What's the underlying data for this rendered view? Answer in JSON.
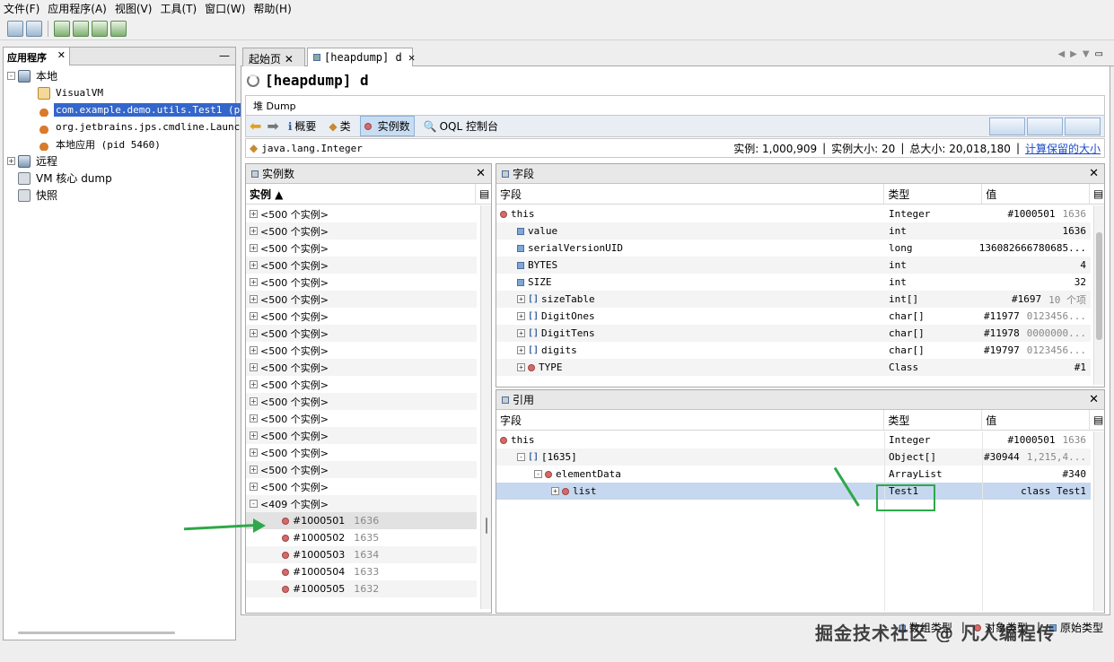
{
  "menu": [
    "文件(F)",
    "应用程序(A)",
    "视图(V)",
    "工具(T)",
    "窗口(W)",
    "帮助(H)"
  ],
  "left": {
    "tab": "应用程序",
    "tree": [
      {
        "label": "本地",
        "icon": "computer-icon",
        "level": 0,
        "exp": "-"
      },
      {
        "label": "VisualVM",
        "icon": "visualvm-icon",
        "level": 1
      },
      {
        "label": "com.example.demo.utils.Test1 (pid",
        "icon": "java-icon",
        "level": 1,
        "selected": true
      },
      {
        "label": "org.jetbrains.jps.cmdline.Launcher",
        "icon": "java-icon",
        "level": 1
      },
      {
        "label": "本地应用 (pid 5460)",
        "icon": "java-icon",
        "level": 1
      },
      {
        "label": "远程",
        "icon": "remote-icon",
        "level": 0,
        "exp": "+"
      },
      {
        "label": "VM 核心 dump",
        "icon": "vm-core-icon",
        "level": 0
      },
      {
        "label": "快照",
        "icon": "snapshot-icon",
        "level": 0
      }
    ]
  },
  "doctabs": [
    "起始页",
    "[heapdump] d"
  ],
  "title": "[heapdump] d",
  "sub": "堆 Dump",
  "views": [
    "概要",
    "类",
    "实例数",
    "OQL 控制台"
  ],
  "classbar": {
    "name": "java.lang.Integer",
    "instances": "实例: 1,000,909",
    "size": "实例大小: 20",
    "total": "总大小: 20,018,180",
    "link": "计算保留的大小"
  },
  "instances": {
    "title": "实例数",
    "col": "实例 ▲",
    "groups": [
      "<500 个实例>",
      "<500 个实例>",
      "<500 个实例>",
      "<500 个实例>",
      "<500 个实例>",
      "<500 个实例>",
      "<500 个实例>",
      "<500 个实例>",
      "<500 个实例>",
      "<500 个实例>",
      "<500 个实例>",
      "<500 个实例>",
      "<500 个实例>",
      "<500 个实例>",
      "<500 个实例>",
      "<500 个实例>",
      "<500 个实例>",
      "<409 个实例>"
    ],
    "items": [
      {
        "id": "#1000501",
        "v": "1636"
      },
      {
        "id": "#1000502",
        "v": "1635"
      },
      {
        "id": "#1000503",
        "v": "1634"
      },
      {
        "id": "#1000504",
        "v": "1633"
      },
      {
        "id": "#1000505",
        "v": "1632"
      }
    ]
  },
  "fields": {
    "title": "字段",
    "cols": [
      "字段",
      "类型",
      "值"
    ],
    "rows": [
      {
        "n": "this",
        "t": "Integer",
        "v": "#1000501",
        "v2": "1636",
        "ic": "dot",
        "ind": 0
      },
      {
        "n": "value",
        "t": "int",
        "v": "1636",
        "ic": "sq",
        "ind": 1
      },
      {
        "n": "serialVersionUID",
        "t": "long",
        "v": "136082666780685...",
        "ic": "sq",
        "ind": 1
      },
      {
        "n": "BYTES",
        "t": "int",
        "v": "4",
        "ic": "sq",
        "ind": 1
      },
      {
        "n": "SIZE",
        "t": "int",
        "v": "32",
        "ic": "sq",
        "ind": 1
      },
      {
        "n": "sizeTable",
        "t": "int[]",
        "v": "#1697",
        "v2": "10 个项",
        "ic": "arr",
        "ind": 1,
        "exp": "+"
      },
      {
        "n": "DigitOnes",
        "t": "char[]",
        "v": "#11977",
        "v2": "0123456...",
        "ic": "arr",
        "ind": 1,
        "exp": "+"
      },
      {
        "n": "DigitTens",
        "t": "char[]",
        "v": "#11978",
        "v2": "0000000...",
        "ic": "arr",
        "ind": 1,
        "exp": "+"
      },
      {
        "n": "digits",
        "t": "char[]",
        "v": "#19797",
        "v2": "0123456...",
        "ic": "arr",
        "ind": 1,
        "exp": "+"
      },
      {
        "n": "TYPE",
        "t": "Class",
        "v": "#1",
        "ic": "dot",
        "ind": 1,
        "exp": "+"
      }
    ]
  },
  "refs": {
    "title": "引用",
    "cols": [
      "字段",
      "类型",
      "值"
    ],
    "rows": [
      {
        "n": "this",
        "t": "Integer",
        "v": "#1000501",
        "v2": "1636",
        "ic": "dot",
        "ind": 0
      },
      {
        "n": "[1635]",
        "t": "Object[]",
        "v": "#30944",
        "v2": "1,215,4...",
        "ic": "arr",
        "ind": 1,
        "exp": "-"
      },
      {
        "n": "elementData",
        "t": "ArrayList",
        "v": "#340",
        "ic": "dot",
        "ind": 2,
        "exp": "-"
      },
      {
        "n": "list",
        "t": "Test1",
        "v": "class Test1",
        "ic": "dot",
        "ind": 3,
        "exp": "+",
        "selected": true
      }
    ]
  },
  "legend": [
    "数组类型",
    "对象类型",
    "原始类型"
  ],
  "watermark": "掘金技术社区 @ 凡人编程传"
}
